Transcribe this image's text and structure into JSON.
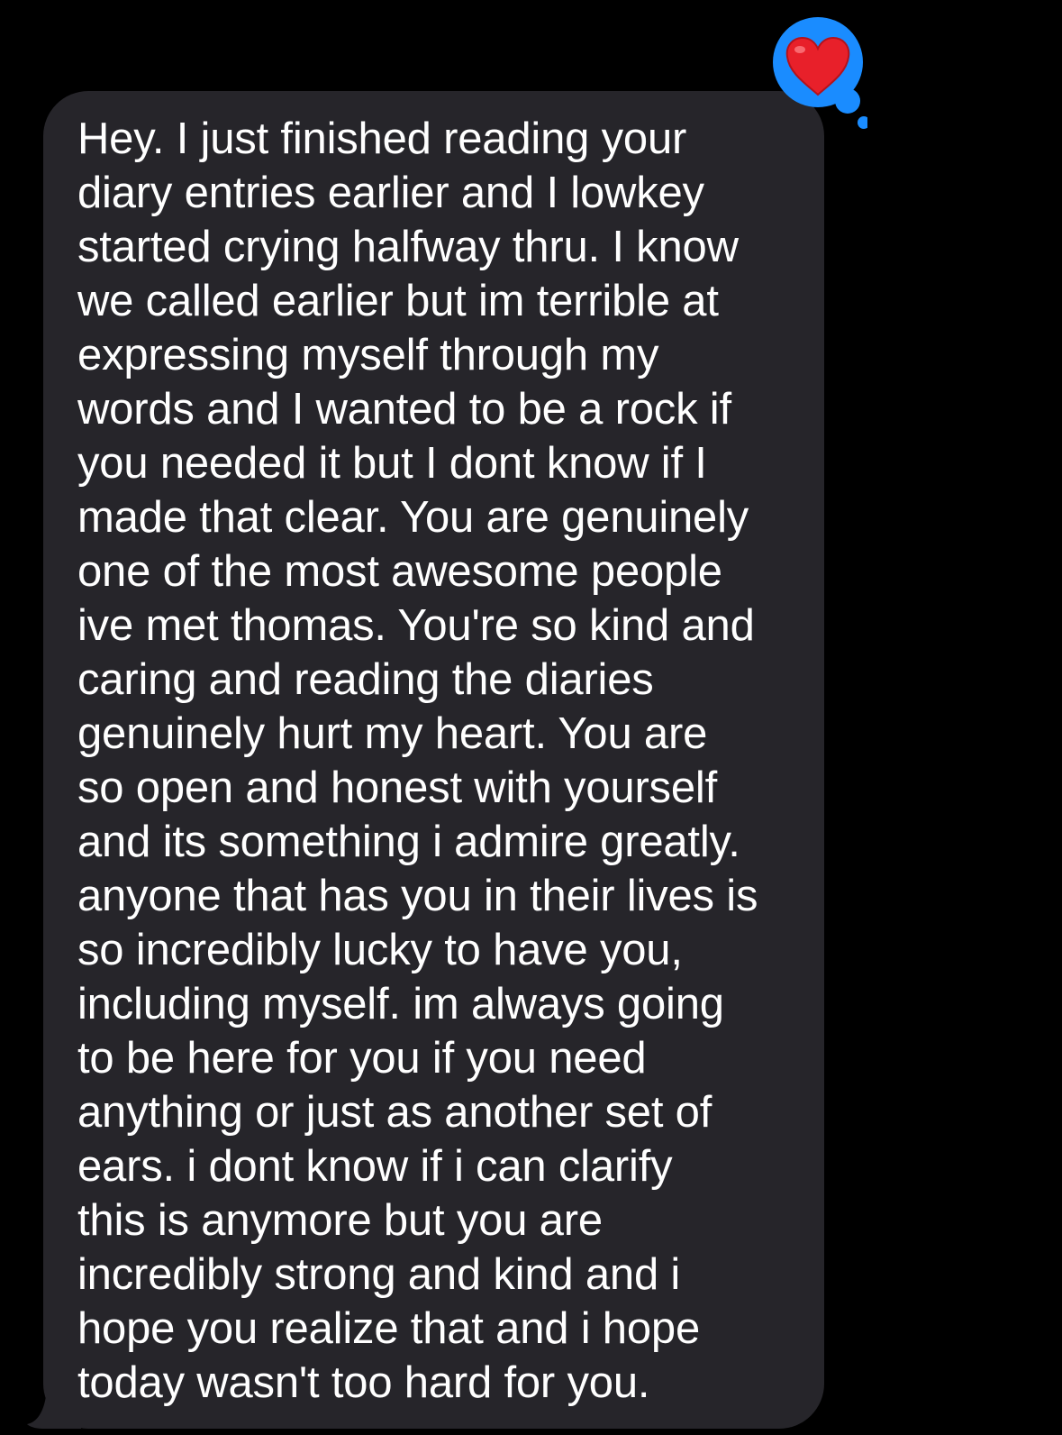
{
  "message": {
    "sender": "incoming",
    "lines": [
      "Hey. I just finished reading your",
      "diary entries earlier and I lowkey",
      "started crying halfway thru. I know",
      "we called earlier but im terrible at",
      "expressing myself through my",
      "words and I wanted to be a rock if",
      "you needed it but I dont know if I",
      "made that clear. You are genuinely",
      "one of the most awesome people",
      "ive met thomas. You're so kind and",
      "caring and reading the diaries",
      "genuinely hurt my heart. You are",
      "so open and honest with yourself",
      "and its something i admire greatly.",
      "anyone that has you in their lives is",
      "so incredibly lucky to have you,",
      "including myself. im always going",
      "to be here for you if you need",
      "anything or just as another set of",
      "ears. i dont know if i can clarify",
      "this is anymore but you are",
      "incredibly strong and kind and i",
      "hope you realize that and i hope",
      "today wasn't too hard for you."
    ],
    "reaction": {
      "icon": "heart-icon",
      "badge_color": "#1a8cff",
      "heart_color": "#e8202a"
    }
  },
  "colors": {
    "background": "#000000",
    "bubble": "#26252a",
    "text": "#ffffff"
  }
}
